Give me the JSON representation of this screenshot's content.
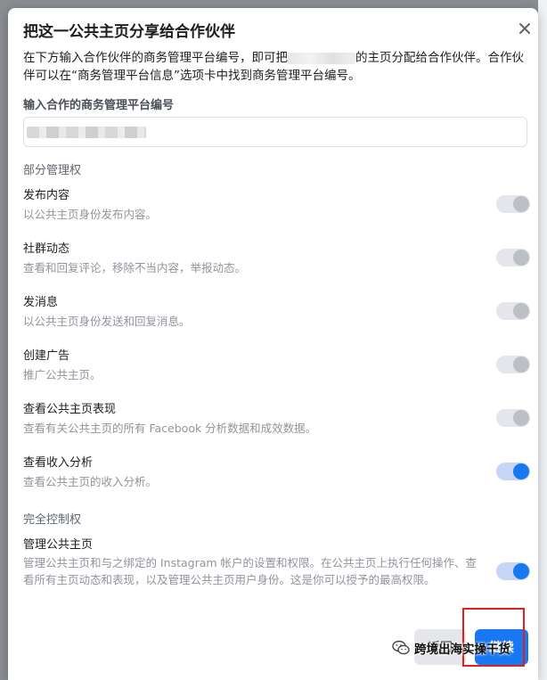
{
  "dialog": {
    "title": "把这一公共主页分享给合作伙伴",
    "desc_part1": "在下方输入合作伙伴的商务管理平台编号，即可把",
    "desc_part2": "的主页分配给合作伙伴。合作伙伴可以在“商务管理平台信息”选项卡中找到商务管理平台编号。",
    "field_label": "输入合作的商务管理平台编号",
    "partial_section": "部分管理权",
    "full_section": "完全控制权",
    "back_label": "返回",
    "continue_label": "继续"
  },
  "permissions": [
    {
      "title": "发布内容",
      "desc": "以公共主页身份发布内容。",
      "enabled": false
    },
    {
      "title": "社群动态",
      "desc": "查看和回复评论，移除不当内容，举报动态。",
      "enabled": false
    },
    {
      "title": "发消息",
      "desc": "以公共主页身份发送和回复消息。",
      "enabled": false
    },
    {
      "title": "创建广告",
      "desc": "推广公共主页。",
      "enabled": false
    },
    {
      "title": "查看公共主页表现",
      "desc": "查看有关公共主页的所有 Facebook 分析数据和成效数据。",
      "enabled": false
    },
    {
      "title": "查看收入分析",
      "desc": "查看公共主页的收入分析。",
      "enabled": true
    }
  ],
  "full_control": {
    "title": "管理公共主页",
    "desc": "管理公共主页和与之绑定的 Instagram 帐户的设置和权限。在公共主页上执行任何操作、查看所有主页动态和表现，以及管理公共主页用户身份。这是你可以授予的最高权限。",
    "enabled": true
  },
  "watermark": {
    "text": "跨境出海实操干货"
  },
  "colors": {
    "accent": "#1877f2",
    "highlight": "#e0201c"
  }
}
